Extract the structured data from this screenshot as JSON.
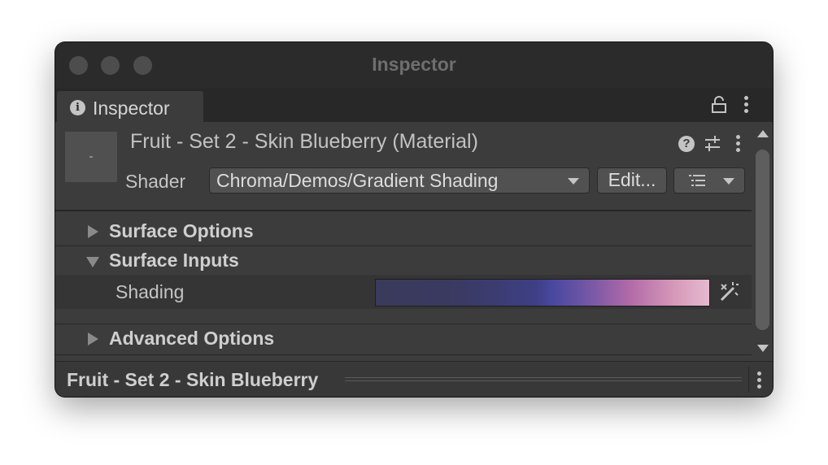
{
  "window": {
    "title": "Inspector"
  },
  "tab": {
    "label": "Inspector",
    "info_icon": "i"
  },
  "material": {
    "title": "Fruit - Set 2 - Skin Blueberry (Material)",
    "help_icon": "?",
    "shader_label": "Shader",
    "shader_value": "Chroma/Demos/Gradient Shading",
    "edit_button": "Edit..."
  },
  "sections": {
    "surface_options": "Surface Options",
    "surface_inputs": "Surface Inputs",
    "advanced_options": "Advanced Options"
  },
  "properties": {
    "shading_label": "Shading",
    "gradient_colors": [
      "#3a3a5c",
      "#3e3f85",
      "#4848a0",
      "#b16aa8",
      "#e6bad0"
    ]
  },
  "footer": {
    "name": "Fruit - Set 2 - Skin Blueberry"
  },
  "icons": [
    "info-icon",
    "lock-icon",
    "kebab-menu-icon",
    "help-icon",
    "presets-icon",
    "list-icon",
    "dropdown-caret-icon",
    "foldout-arrow-icon",
    "magic-wand-icon",
    "scroll-up-icon",
    "scroll-down-icon"
  ]
}
